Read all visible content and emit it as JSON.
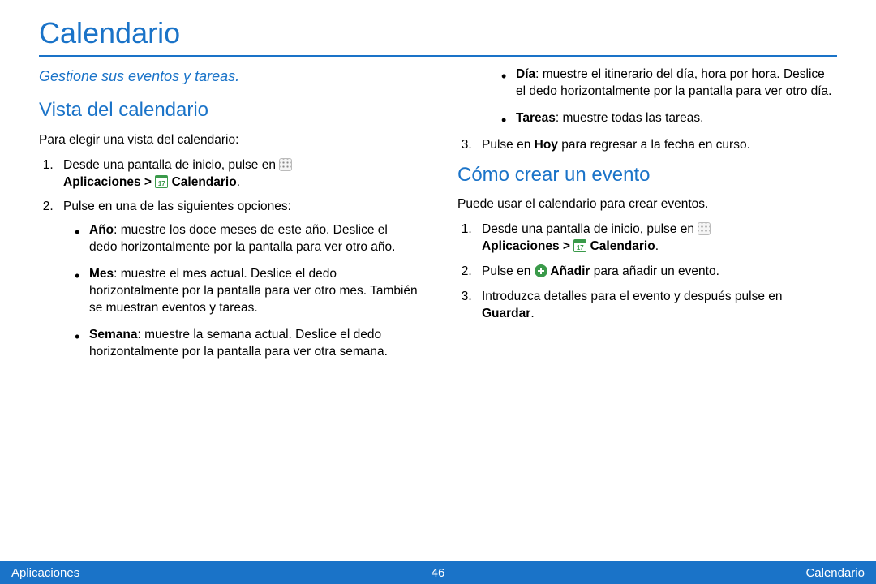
{
  "title": "Calendario",
  "subtitle": "Gestione sus eventos y tareas.",
  "section1": {
    "heading": "Vista del calendario",
    "intro": "Para elegir una vista del calendario:",
    "step1_a": "Desde una pantalla de inicio, pulse en ",
    "step1_apps": "Aplicaciones",
    "step1_gt": " > ",
    "step1_cal": " Calendario",
    "step1_dot": ".",
    "step2": "Pulse en una de las siguientes opciones:",
    "bul_ano_b": "Año",
    "bul_ano_t": ": muestre los doce meses de este año. Deslice el dedo horizontalmente por la pantalla para ver otro año.",
    "bul_mes_b": "Mes",
    "bul_mes_t": ": muestre el mes actual. Deslice el dedo horizontalmente por la pantalla para ver otro mes. También se muestran eventos y tareas.",
    "bul_sem_b": "Semana",
    "bul_sem_t": ": muestre la semana actual. Deslice el dedo horizontalmente por la pantalla para ver otra semana.",
    "bul_dia_b": "Día",
    "bul_dia_t": ": muestre el itinerario del día, hora por hora. Deslice el dedo horizontalmente por la pantalla para ver otro día.",
    "bul_tar_b": "Tareas",
    "bul_tar_t": ": muestre todas las tareas.",
    "step3_a": "Pulse en ",
    "step3_hoy": "Hoy",
    "step3_b": " para regresar a la fecha en curso."
  },
  "section2": {
    "heading": "Cómo crear un evento",
    "intro": "Puede usar el calendario para crear eventos.",
    "step1_a": "Desde una pantalla de inicio, pulse en ",
    "step1_apps": "Aplicaciones",
    "step1_gt": " > ",
    "step1_cal": " Calendario",
    "step1_dot": ".",
    "step2_a": "Pulse en ",
    "step2_add": " Añadir",
    "step2_b": " para añadir un evento.",
    "step3_a": "Introduzca detalles para el evento y después pulse en ",
    "step3_save": "Guardar",
    "step3_dot": "."
  },
  "footer": {
    "left": "Aplicaciones",
    "center": "46",
    "right": "Calendario"
  }
}
